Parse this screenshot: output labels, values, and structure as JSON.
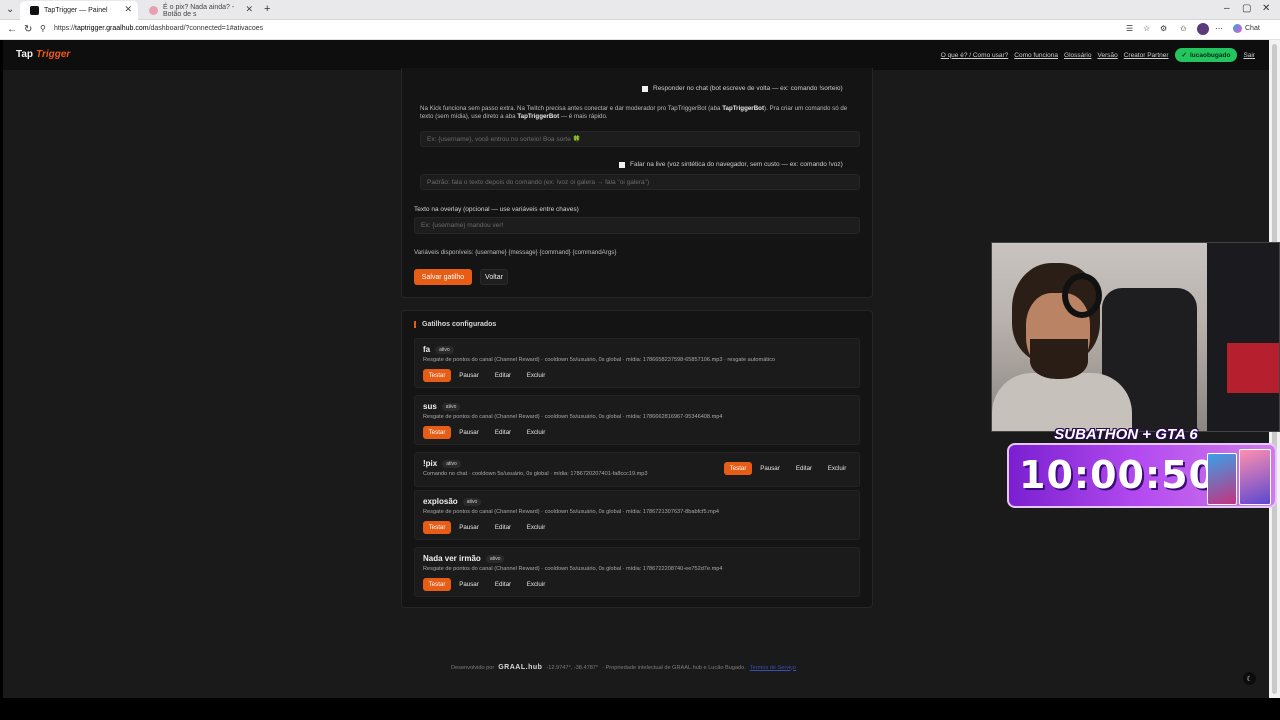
{
  "browser": {
    "tabs": [
      {
        "title": "TapTrigger — Painel",
        "active": true
      },
      {
        "title": "É o pix? Nada ainda? - Botão de s",
        "active": false
      }
    ],
    "url_prefix": "https://",
    "url_domain": "taptrigger.graalhub.com",
    "url_path": "/dashboard/?connected=1#ativacoes",
    "chat_label": "Chat"
  },
  "header": {
    "logo_a": "Tap",
    "logo_b": "Trigger",
    "nav": [
      "O que é? / Como usar?",
      "Como funciona",
      "Glossário",
      "Versão",
      "Creator Partner"
    ],
    "user": "lucaobugado",
    "logout": "Sair"
  },
  "form": {
    "reply_chat_label": "Responder no chat (bot escreve de volta — ex: comando !sorteio)",
    "note_1": "Na Kick funciona sem passo extra. Na Twitch precisa antes conectar e dar moderador pro TapTriggerBot (aba ",
    "note_bold_1": "TapTriggerBot",
    "note_2": "). Pra criar um comando só de texto (sem mídia), use direto a aba ",
    "note_bold_2": "TapTriggerBot",
    "note_3": " — é mais rápido.",
    "reply_placeholder": "Ex: {username}, você entrou no sorteio! Boa sorte 🍀",
    "tts_label": "Falar na live (voz sintética do navegador, sem custo — ex: comando !voz)",
    "tts_placeholder": "Padrão: fala o texto depois do comando (ex: !voz oi galera → fala \"oi galera\")",
    "overlay_label": "Texto na overlay (opcional — use variáveis entre chaves)",
    "overlay_placeholder": "Ex: {username} mandou ver!",
    "vars": "Variáveis disponíveis: {username} {message} {command} {commandArgs}",
    "save": "Salvar gatilho",
    "back": "Voltar"
  },
  "triggers": {
    "title": "Gatilhos configurados",
    "active_badge": "ativo",
    "actions": {
      "test": "Testar",
      "pause": "Pausar",
      "edit": "Editar",
      "delete": "Excluir"
    },
    "items": [
      {
        "name": "fa",
        "desc": "Resgate de pontos do canal (Channel Reward) · cooldown 5s/usuário, 0s global · mídia: 1786658237598-65857106.mp3 · resgate automático"
      },
      {
        "name": "sus",
        "desc": "Resgate de pontos do canal (Channel Reward) · cooldown 5s/usuário, 0s global · mídia: 1786662816967-95346408.mp4"
      },
      {
        "name": "!pix",
        "desc": "Comando no chat · cooldown 5s/usuário, 0s global · mídia: 1786720207401-fa8ccc19.mp3"
      },
      {
        "name": "explosão",
        "desc": "Resgate de pontos do canal (Channel Reward) · cooldown 5s/usuário, 0s global · mídia: 1786721307637-8babfcf5.mp4"
      },
      {
        "name": "Nada ver irmão",
        "desc": "Resgate de pontos do canal (Channel Reward) · cooldown 5s/usuário, 0s global · mídia: 1786722208740-ee752d7e.mp4"
      }
    ]
  },
  "footer": {
    "dev_by": "Desenvolvido por",
    "brand": "GRAAL.hub",
    "coords": "-12.9747°, -38.4787°",
    "rights": "· Propriedade intelectual de GRAAL.hub e Lucão Bugado.",
    "link": "Termos de Serviço"
  },
  "overlay": {
    "banner": "SUBATHON + GTA 6",
    "timer": "10:00:50"
  },
  "colors": {
    "accent": "#e85d16",
    "success": "#22c55e",
    "page_bg": "#1a1a1b"
  }
}
